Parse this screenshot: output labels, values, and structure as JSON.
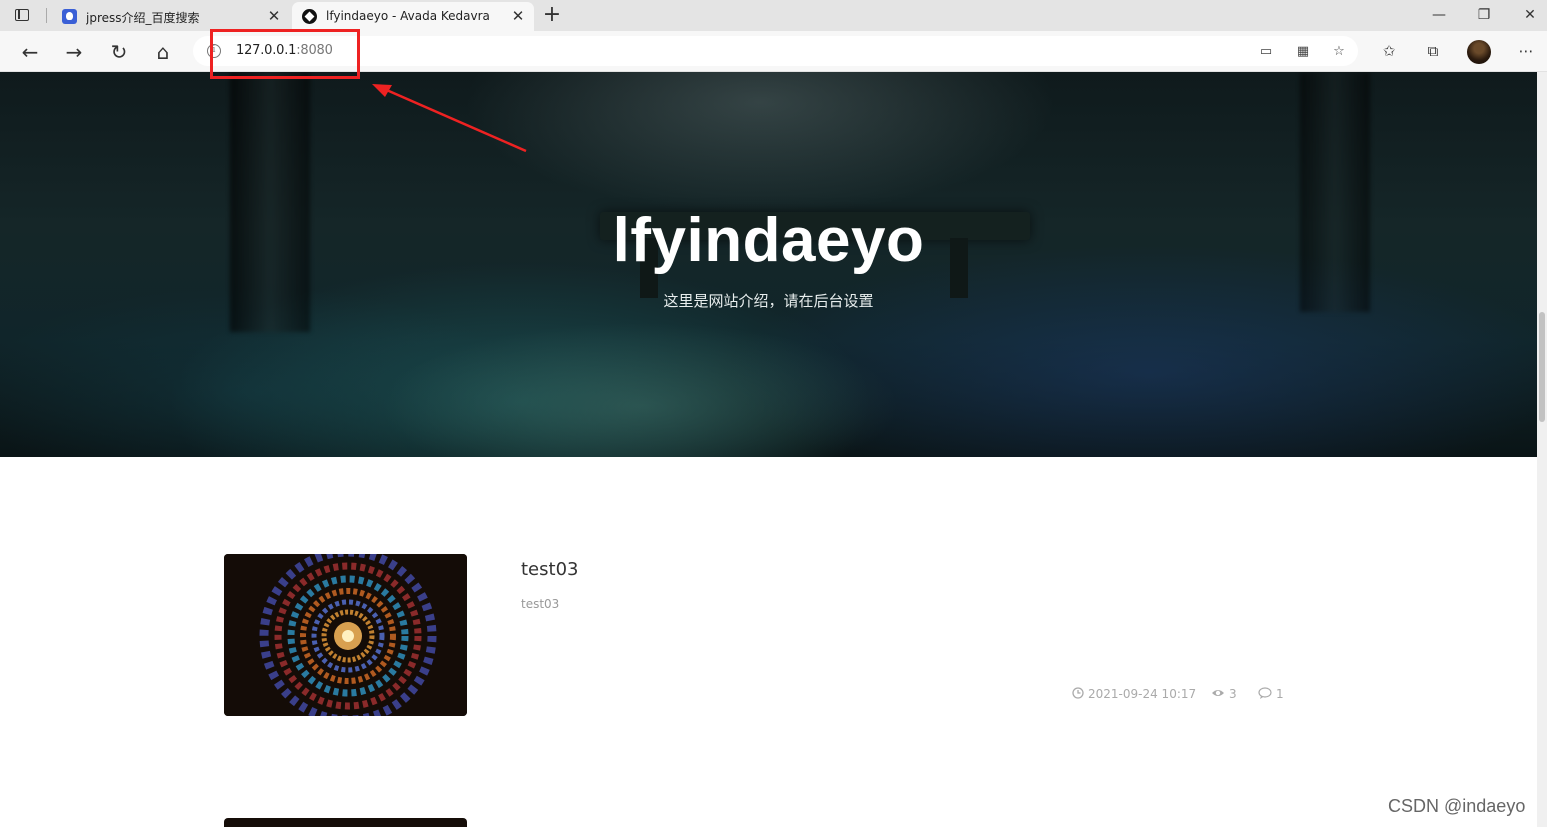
{
  "browser": {
    "tabs": [
      {
        "title": "jpress介绍_百度搜索",
        "active": false,
        "icon": "baidu-paw-icon"
      },
      {
        "title": "lfyindaeyo - Avada Kedavra",
        "active": true,
        "icon": "site-logo-icon"
      }
    ],
    "address": {
      "host": "127.0.0.1",
      "port": ":8080"
    },
    "window_controls": {
      "minimize": "—",
      "restore": "❐",
      "close": "✕"
    }
  },
  "hero": {
    "title": "lfyindaeyo",
    "description": "这里是网站介绍，请在后台设置"
  },
  "posts": [
    {
      "title": "test03",
      "summary": "test03",
      "date": "2021-09-24 10:17",
      "views": "3",
      "comments": "1"
    }
  ],
  "watermark": "CSDN @indaeyo",
  "colors": {
    "annotation_red": "#ee2222"
  }
}
